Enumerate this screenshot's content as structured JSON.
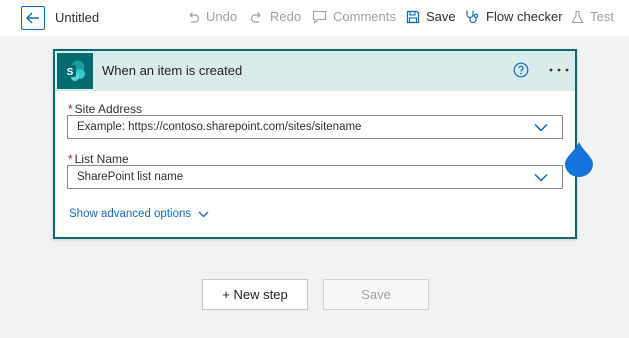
{
  "header": {
    "title": "Untitled",
    "commands": {
      "undo": "Undo",
      "redo": "Redo",
      "comments": "Comments",
      "save": "Save",
      "flow_checker": "Flow checker",
      "test": "Test"
    }
  },
  "trigger_card": {
    "title": "When an item is created",
    "site_address": {
      "label": "Site Address",
      "required_mark": "*",
      "placeholder": "Example: https://contoso.sharepoint.com/sites/sitename"
    },
    "list_name": {
      "label": "List Name",
      "required_mark": "*",
      "placeholder": "SharePoint list name"
    },
    "advanced_options": "Show advanced options",
    "icons": [
      "sharepoint-icon",
      "help-icon",
      "more-options-icon"
    ]
  },
  "footer": {
    "new_step": "+ New step",
    "save": "Save"
  },
  "colors": {
    "accent": "#0f6cbd",
    "sharepoint": "#036c70",
    "header_tint": "#d9ebeb",
    "required": "#a4262c"
  }
}
